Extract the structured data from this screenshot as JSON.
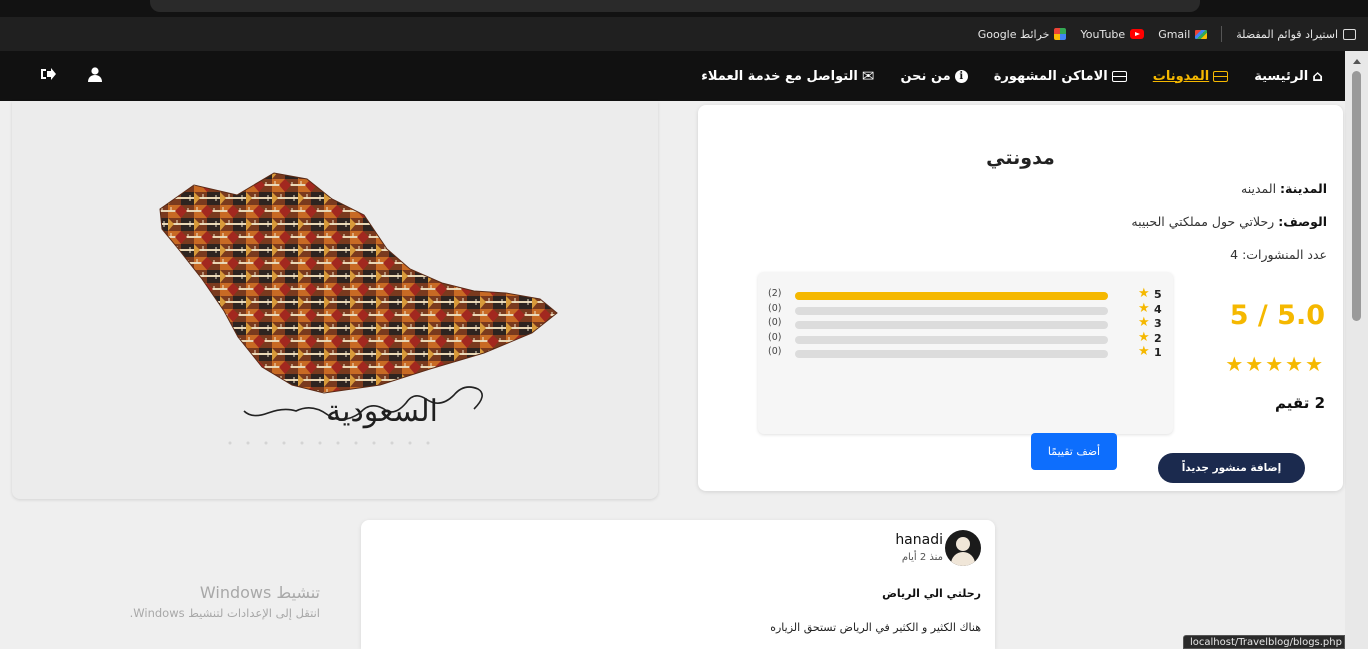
{
  "bookmarks": {
    "import_label": "استيراد قوائم المفضلة",
    "gmail": "Gmail",
    "youtube": "YouTube",
    "maps": "خرائط Google"
  },
  "nav": {
    "home": "الرئيسية",
    "blogs": "المدونات",
    "places": "الاماكن المشهورة",
    "about": "من نحن",
    "contact": "التواصل مع خدمة العملاء"
  },
  "hero": {
    "calligraphy": "السعودية"
  },
  "blog": {
    "title": "مدونتي",
    "city_label": "المدينة:",
    "city_value": "المدينه",
    "desc_label": "الوصف:",
    "desc_value": "رحلاتي حول مملكتي الحبيبه",
    "posts_label": "عدد المنشورات:",
    "posts_value": "4",
    "rating_display": "5 / 5.0",
    "stars": "★★★★★",
    "ratings_count": "2 تقيم",
    "rate_button": "أضف تقييمًا",
    "add_post_button": "إضافة منشور جديداً",
    "accent_color": "#f5b800"
  },
  "rating_distribution": [
    {
      "stars": "5",
      "count_label": "(2)",
      "fraction": 1.0
    },
    {
      "stars": "4",
      "count_label": "(0)",
      "fraction": 0
    },
    {
      "stars": "3",
      "count_label": "(0)",
      "fraction": 0
    },
    {
      "stars": "2",
      "count_label": "(0)",
      "fraction": 0
    },
    {
      "stars": "1",
      "count_label": "(0)",
      "fraction": 0
    }
  ],
  "post": {
    "username": "hanadi",
    "time": "منذ 2 أيام",
    "title": "رحلتي الي الرياض",
    "body": "هناك الكثير و الكثير في الرياض تستحق الزياره"
  },
  "windows": {
    "title": "تنشيط Windows",
    "subtitle": "انتقل إلى الإعدادات لتنشيط Windows."
  },
  "status_url": "localhost/Travelblog/blogs.php"
}
